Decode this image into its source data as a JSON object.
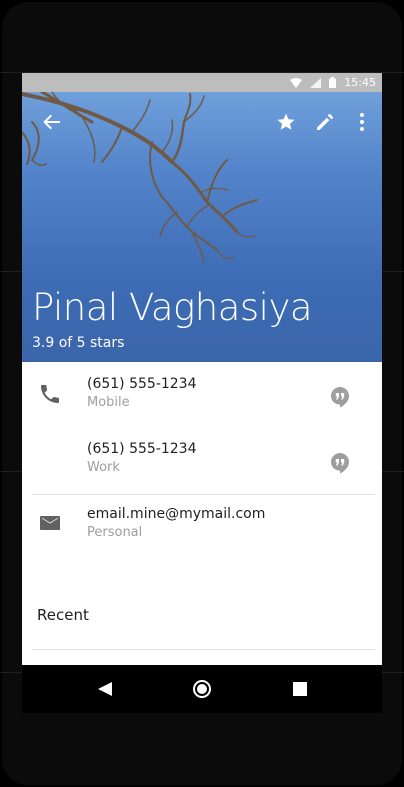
{
  "status_bar": {
    "time": "15:45",
    "icons": [
      "wifi-icon",
      "cell-signal-icon",
      "battery-icon"
    ]
  },
  "toolbar": {
    "icons": [
      "back-arrow-icon",
      "star-icon",
      "edit-pencil-icon",
      "more-vert-icon"
    ]
  },
  "contact": {
    "name": "Pinal Vaghasiya",
    "rating_text": "3.9 of 5 stars"
  },
  "phones": [
    {
      "number": "(651) 555-1234",
      "type": "Mobile"
    },
    {
      "number": "(651) 555-1234",
      "type": "Work"
    }
  ],
  "email": {
    "address": "email.mine@mymail.com",
    "type": "Personal"
  },
  "recent": {
    "label": "Recent"
  },
  "nav": {
    "icons": [
      "back-triangle-icon",
      "home-circle-icon",
      "recents-square-icon"
    ]
  },
  "colors": {
    "hero_sky": "#4a78c0",
    "status_bar": "#bdbdbd",
    "icon_grey": "#757575",
    "secondary_text": "#9e9e9e"
  }
}
